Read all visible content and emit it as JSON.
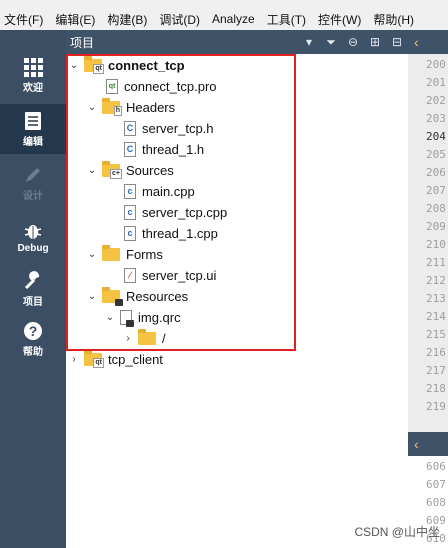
{
  "menu": [
    "文件(F)",
    "编辑(E)",
    "构建(B)",
    "调试(D)",
    "Analyze",
    "工具(T)",
    "控件(W)",
    "帮助(H)"
  ],
  "modes": [
    {
      "label": "欢迎",
      "icon": "grid-icon"
    },
    {
      "label": "编辑",
      "icon": "document-icon"
    },
    {
      "label": "设计",
      "icon": "pencil-icon"
    },
    {
      "label": "Debug",
      "icon": "bug-icon"
    },
    {
      "label": "项目",
      "icon": "wrench-icon"
    },
    {
      "label": "帮助",
      "icon": "help-icon"
    }
  ],
  "pane": {
    "title": "项目"
  },
  "tree": {
    "project": "connect_tcp",
    "pro": "connect_tcp.pro",
    "headers": {
      "label": "Headers",
      "files": [
        "server_tcp.h",
        "thread_1.h"
      ]
    },
    "sources": {
      "label": "Sources",
      "files": [
        "main.cpp",
        "server_tcp.cpp",
        "thread_1.cpp"
      ]
    },
    "forms": {
      "label": "Forms",
      "files": [
        "server_tcp.ui"
      ]
    },
    "resources": {
      "label": "Resources",
      "qrc": "img.qrc",
      "prefix": "/"
    },
    "other_project": "tcp_client"
  },
  "editor": {
    "lines_top": [
      "200",
      "201",
      "202",
      "203",
      "204",
      "205",
      "206",
      "207",
      "208",
      "209",
      "210",
      "211",
      "212",
      "213",
      "214",
      "215",
      "216",
      "217",
      "218",
      "219"
    ],
    "lines_bottom": [
      "606",
      "607",
      "608",
      "609",
      "610"
    ]
  },
  "watermark": "CSDN @山中坐",
  "colors": {
    "highlight": "#e32020",
    "modebar": "#3b4e63",
    "folder": "#f5c242"
  }
}
